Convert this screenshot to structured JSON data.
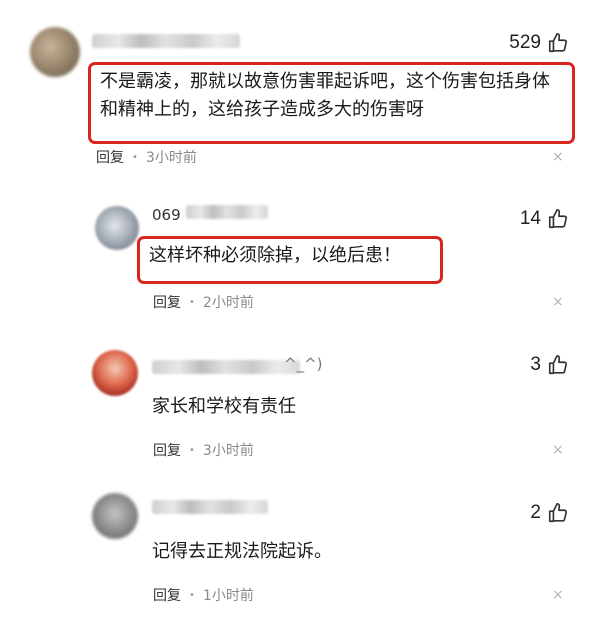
{
  "comments": [
    {
      "name": "",
      "likes": "529",
      "text": "不是霸凌，那就以故意伤害罪起诉吧，这个伤害包括身体和精神上的，这给孩子造成多大的伤害呀",
      "reply": "回复",
      "time": "3小时前",
      "close": "×"
    },
    {
      "name": "069",
      "likes": "14",
      "text": "这样坏种必须除掉，以绝后患！",
      "reply": "回复",
      "time": "2小时前",
      "close": "×"
    },
    {
      "name": "^_^)",
      "likes": "3",
      "text": "家长和学校有责任",
      "reply": "回复",
      "time": "3小时前",
      "close": "×"
    },
    {
      "name": "",
      "likes": "2",
      "text": "记得去正规法院起诉。",
      "reply": "回复",
      "time": "1小时前",
      "close": "×"
    }
  ],
  "icons": {
    "like": "thumbs-up-icon",
    "close": "close-icon"
  },
  "colors": {
    "highlight_border": "#d8261f",
    "muted": "#8a8a8a"
  }
}
